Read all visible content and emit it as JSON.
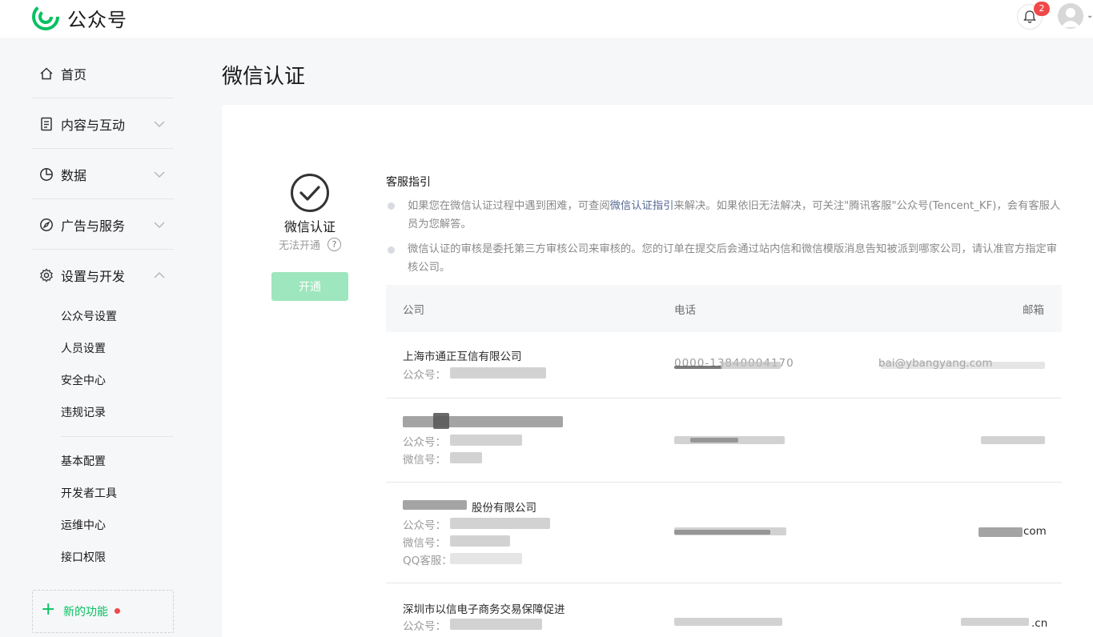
{
  "header": {
    "brand": "公众号",
    "notification_count": "2"
  },
  "sidebar": {
    "items": [
      {
        "label": "首页",
        "icon": "home-icon"
      },
      {
        "label": "内容与互动",
        "icon": "document-icon"
      },
      {
        "label": "数据",
        "icon": "pie-chart-icon"
      },
      {
        "label": "广告与服务",
        "icon": "compass-icon"
      },
      {
        "label": "设置与开发",
        "icon": "gear-icon"
      }
    ],
    "sub_items_group1": [
      "公众号设置",
      "人员设置",
      "安全中心",
      "违规记录"
    ],
    "sub_items_group2": [
      "基本配置",
      "开发者工具",
      "运维中心",
      "接口权限"
    ],
    "new_feature_label": "新的功能"
  },
  "page": {
    "title": "微信认证"
  },
  "cert": {
    "title": "微信认证",
    "status": "无法开通",
    "help": "?",
    "button": "开通"
  },
  "guide": {
    "title": "客服指引",
    "p1_before": "如果您在微信认证过程中遇到困难，可查阅",
    "p1_link": "微信认证指引",
    "p1_after": "来解决。如果依旧无法解决，可关注\"腾讯客服\"公众号(Tencent_KF)，会有客服人员为您解答。",
    "p2": "微信认证的审核是委托第三方审核公司来审核的。您的订单在提交后会通过站内信和微信模版消息告知被派到哪家公司，请认准官方指定审核公司。"
  },
  "table": {
    "headers": [
      "公司",
      "电话",
      "邮箱"
    ],
    "rows": [
      {
        "name": "上海市通正互信有限公司",
        "sub1": "公众号：",
        "phone": "0000-13840004170",
        "email": "bai@ybangyang.com"
      },
      {
        "name": "",
        "sub1": "公众号：",
        "sub2": "微信号：",
        "phone": "",
        "email": ""
      },
      {
        "name": "股份有限公司",
        "sub1": "公众号：",
        "sub2": "微信号：",
        "sub3": "QQ客服：",
        "phone": "",
        "email": "com"
      },
      {
        "name": "深圳市以信电子商务交易保障促进",
        "sub1": "公众号：",
        "phone": "",
        "email": ".cn"
      }
    ]
  },
  "colors": {
    "accent": "#07c160",
    "button_disabled": "#9ee6be",
    "link": "#576b95",
    "badge": "#f04848"
  }
}
